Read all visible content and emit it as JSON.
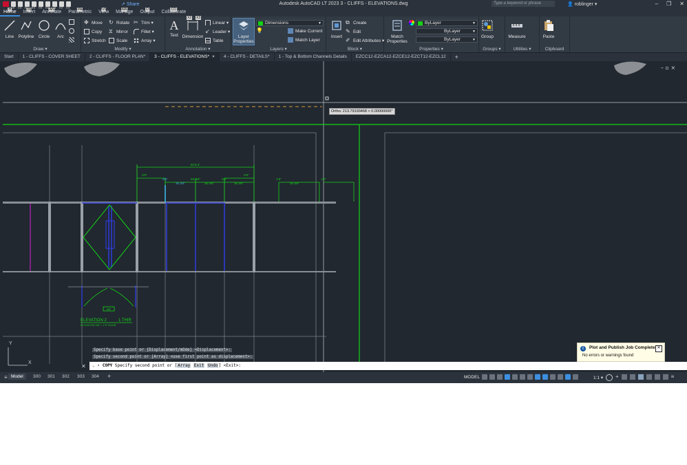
{
  "title_bar": {
    "window_title": "Autodesk AutoCAD LT 2023    3 - CLIFFS - ELEVATIONS.dwg",
    "share": "Share",
    "search_placeholder": "Type a keyword or phrase",
    "user": "roblinger",
    "qat_badges": [
      "1",
      "2",
      "3",
      "4",
      "5",
      "6",
      "7",
      "8",
      "9"
    ]
  },
  "ribbon_tabs": [
    {
      "label": "Home",
      "key": "H"
    },
    {
      "label": "Insert",
      "key": "IN"
    },
    {
      "label": "Annotate",
      "key": "AN"
    },
    {
      "label": "Parametric",
      "key": "PA"
    },
    {
      "label": "View",
      "key": "VI"
    },
    {
      "label": "Manage",
      "key": "MA"
    },
    {
      "label": "Output",
      "key": "O"
    },
    {
      "label": "Collaborate",
      "key": "CO"
    }
  ],
  "ribbon_extra_badges": [
    "X2",
    "X3"
  ],
  "ribbon": {
    "draw": {
      "title": "Draw ▾",
      "line": "Line",
      "polyline": "Polyline",
      "circle": "Circle",
      "arc": "Arc"
    },
    "modify": {
      "title": "Modify ▾",
      "move": "Move",
      "rotate": "Rotate",
      "trim": "Trim ▾",
      "copy": "Copy",
      "mirror": "Mirror",
      "fillet": "Fillet ▾",
      "stretch": "Stretch",
      "scale": "Scale",
      "array": "Array ▾"
    },
    "annotation": {
      "title": "Annotation ▾",
      "text": "Text",
      "dimension": "Dimension",
      "linear": "Linear ▾",
      "leader": "Leader ▾",
      "table": "Table"
    },
    "layers": {
      "title": "Layers ▾",
      "layer_properties": "Layer Properties",
      "current_layer": "Dimensions",
      "make_current": "Make Current",
      "match_layer": "Match Layer"
    },
    "block": {
      "title": "Block ▾",
      "insert": "Insert",
      "create": "Create",
      "edit": "Edit",
      "edit_attributes": "Edit Attributes ▾"
    },
    "properties": {
      "title": "Properties ▾",
      "match_properties": "Match Properties",
      "color": "ByLayer",
      "linetype": "ByLayer",
      "lineweight": "ByLayer"
    },
    "groups": {
      "title": "Groups ▾",
      "group": "Group"
    },
    "utilities": {
      "title": "Utilities ▾",
      "measure": "Measure"
    },
    "clipboard": {
      "title": "Clipboard",
      "paste": "Paste"
    }
  },
  "file_tabs": [
    {
      "label": "Start"
    },
    {
      "label": "1 - CLIFFS - COVER SHEET"
    },
    {
      "label": "2 - CLIFFS - FLOOR PLAN*"
    },
    {
      "label": "3 - CLIFFS - ELEVATIONS*"
    },
    {
      "label": "4 - CLIFFS - DETAILS*"
    },
    {
      "label": "1 - Top & Bottom Channels Details"
    },
    {
      "label": "EZCC12-EZCA12-EZCE12-EZCT12-EZCL12"
    }
  ],
  "drawing": {
    "ortho_tooltip": "Ortho: 213.79193468 < 0.00000000°",
    "dims": {
      "overall": "91'6-4\"",
      "d1": "5'6\"",
      "d2": "5'6\"",
      "d3": "5'6\"",
      "d4": "35 3/4\"",
      "d5": "35 3/4\"",
      "d6": "25 3/4\"",
      "d7": "35 3/4\"",
      "d8": "35 3/4\"",
      "d9": "1'6\"",
      "d10": "5'6\"",
      "d11": "1'6\""
    },
    "elevation_label": "ELEVATION 2",
    "elevation_scale": "1 THIR",
    "elevation_sub": "ELEVATION 3/8\" = 1'0\" DOOR",
    "door_tag": "MR",
    "ucs_x": "X",
    "ucs_y": "Y"
  },
  "command": {
    "history1": "Specify base point or [Displacement/mOde] <Displacement>:",
    "history2": "Specify second point or [Array] <use first point as displacement>:",
    "prefix": "COPY",
    "prompt_start": "Specify second point or [",
    "opt1": "Array",
    "opt2": "Exit",
    "opt3": "Undo",
    "prompt_end": "] <Exit>:"
  },
  "notification": {
    "title": "Plot and Publish Job Complete",
    "message": "No errors or warnings found"
  },
  "status_bar": {
    "layouts": [
      "Model",
      "300",
      "301",
      "302",
      "303",
      "304"
    ],
    "model_label": "MODEL",
    "scale": "1:1 ▾"
  },
  "colors": {
    "accent": "#3c8fe0",
    "green": "#14d414",
    "blue": "#2e3bd6",
    "magenta": "#d81bd8",
    "canvas": "#212830"
  }
}
